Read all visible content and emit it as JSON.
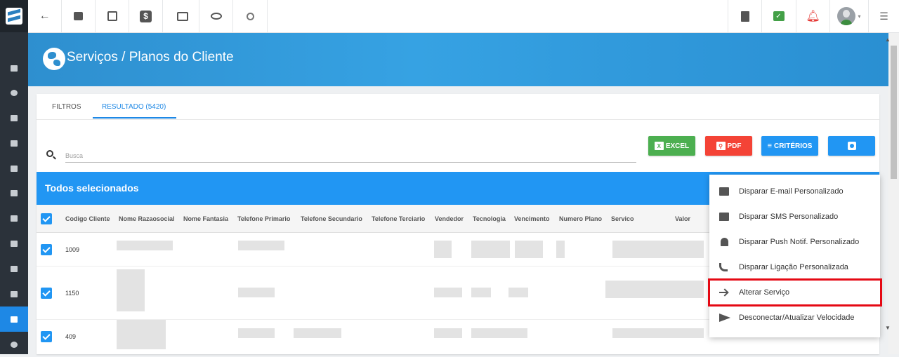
{
  "app": {
    "logo": "app-logo"
  },
  "topbar": {
    "left_icons": [
      "arrow-left-icon",
      "contact-card-icon",
      "calendar-clock-icon",
      "dollar-icon",
      "terminal-icon",
      "eye-icon",
      "search-icon"
    ],
    "right_icons": [
      "pdf-file-icon",
      "chat-check-icon",
      "alarm-bell-icon",
      "user-avatar",
      "menu-list-icon"
    ],
    "dollar_glyph": "$"
  },
  "header": {
    "title": "Serviços / Planos do Cliente"
  },
  "tabs": [
    {
      "label": "FILTROS",
      "active": false
    },
    {
      "label": "RESULTADO (5420)",
      "active": true
    }
  ],
  "search": {
    "placeholder": "Busca"
  },
  "actions": {
    "excel": "EXCEL",
    "pdf": "PDF",
    "criteria": "CRITÉRIOS"
  },
  "selection_bar": {
    "text": "Todos selecionados"
  },
  "table": {
    "columns": [
      "Codigo Cliente",
      "Nome Razaosocial",
      "Nome Fantasia",
      "Telefone Primario",
      "Telefone Secundario",
      "Telefone Terciario",
      "Vendedor",
      "Tecnologia",
      "Vencimento",
      "Numero Plano",
      "Servico",
      "Valor"
    ],
    "rows": [
      {
        "code": "1009",
        "checked": true
      },
      {
        "code": "1150",
        "checked": true
      },
      {
        "code": "409",
        "checked": true
      }
    ]
  },
  "menu": {
    "items": [
      {
        "label": "Disparar E-mail Personalizado",
        "icon": "mail-icon"
      },
      {
        "label": "Disparar SMS Personalizado",
        "icon": "chat-icon"
      },
      {
        "label": "Disparar Push Notif. Personalizado",
        "icon": "bell-icon"
      },
      {
        "label": "Disparar Ligação Personalizada",
        "icon": "phone-icon"
      },
      {
        "label": "Alterar Serviço",
        "icon": "arrow-right-icon",
        "highlighted": true
      },
      {
        "label": "Desconectar/Atualizar Velocidade",
        "icon": "send-icon"
      }
    ],
    "highlight_color": "#e50914"
  },
  "colors": {
    "primary": "#2196f3",
    "excel": "#4caf50",
    "pdf": "#f44336",
    "sidebar": "#2b323a",
    "active_sidebar": "#1e88e5"
  }
}
